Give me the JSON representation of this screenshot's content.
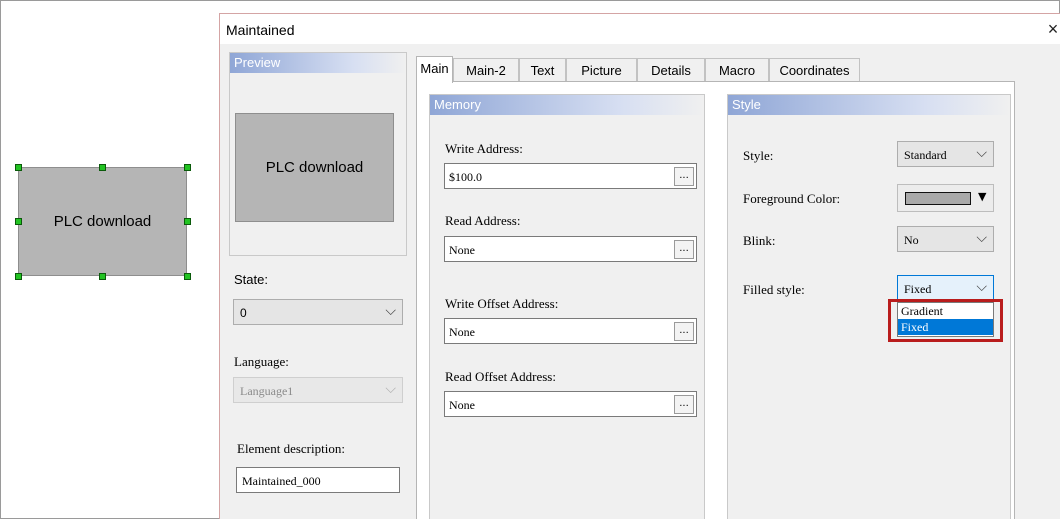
{
  "canvas": {
    "element_label": "PLC download"
  },
  "dialog": {
    "title": "Maintained",
    "close_symbol": "×",
    "preview": {
      "header": "Preview",
      "button_label": "PLC download"
    },
    "left": {
      "state_label": "State:",
      "state_value": "0",
      "language_label": "Language:",
      "language_value": "Language1",
      "description_label": "Element description:",
      "description_value": "Maintained_000"
    },
    "tabs": [
      {
        "label": "Main",
        "active": true
      },
      {
        "label": "Main-2",
        "active": false
      },
      {
        "label": "Text",
        "active": false
      },
      {
        "label": "Picture",
        "active": false
      },
      {
        "label": "Details",
        "active": false
      },
      {
        "label": "Macro",
        "active": false
      },
      {
        "label": "Coordinates",
        "active": false
      }
    ],
    "memory": {
      "header": "Memory",
      "write_address_label": "Write Address:",
      "write_address_value": "$100.0",
      "read_address_label": "Read Address:",
      "read_address_value": "None",
      "write_offset_label": "Write Offset Address:",
      "write_offset_value": "None",
      "read_offset_label": "Read Offset Address:",
      "read_offset_value": "None",
      "browse_label": "..."
    },
    "style": {
      "header": "Style",
      "style_label": "Style:",
      "style_value": "Standard",
      "foreground_label": "Foreground Color:",
      "foreground_color": "#a9a9a9",
      "blink_label": "Blink:",
      "blink_value": "No",
      "filled_label": "Filled style:",
      "filled_value": "Fixed",
      "filled_options": [
        "Gradient",
        "Fixed"
      ],
      "filled_selected": "Fixed"
    }
  },
  "colors": {
    "accent_highlight": "#b91c1c",
    "selection": "#0078d7",
    "group_header": "#8fa6d6"
  }
}
